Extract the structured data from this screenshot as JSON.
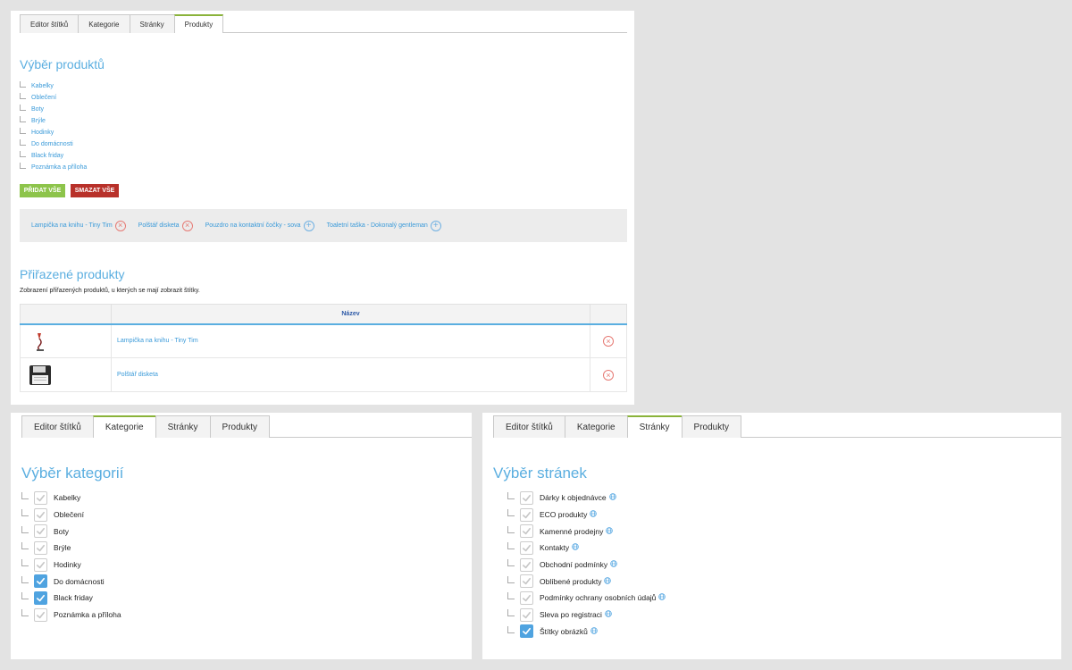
{
  "tabs": [
    "Editor štítků",
    "Kategorie",
    "Stránky",
    "Produkty"
  ],
  "products_panel": {
    "active_tab": "Produkty",
    "heading": "Výběr produktů",
    "tree": [
      "Kabelky",
      "Oblečení",
      "Boty",
      "Brýle",
      "Hodinky",
      "Do domácnosti",
      "Black friday",
      "Poznámka a příloha"
    ],
    "add_all_label": "PŘIDAT VŠE",
    "delete_all_label": "SMAZAT VŠE",
    "chips": [
      {
        "label": "Lampička na knihu - Tiny Tim",
        "action": "remove"
      },
      {
        "label": "Polštář disketa",
        "action": "remove"
      },
      {
        "label": "Pouzdro na kontaktní čočky - sova",
        "action": "add"
      },
      {
        "label": "Toaletní taška - Dokonalý gentleman",
        "action": "add"
      }
    ],
    "assigned_heading": "Přiřazené produkty",
    "assigned_description": "Zobrazení přiřazených produktů, u kterých se mají zobrazit štítky.",
    "table_header_name": "Název",
    "rows": [
      {
        "name": "Lampička na knihu - Tiny Tim",
        "image": "lamp-thumbnail"
      },
      {
        "name": "Polštář disketa",
        "image": "floppy-pillow-thumbnail"
      }
    ]
  },
  "categories_panel": {
    "active_tab": "Kategorie",
    "heading": "Výběr kategorií",
    "items": [
      {
        "label": "Kabelky",
        "checked": false
      },
      {
        "label": "Oblečení",
        "checked": false
      },
      {
        "label": "Boty",
        "checked": false
      },
      {
        "label": "Brýle",
        "checked": false
      },
      {
        "label": "Hodinky",
        "checked": false
      },
      {
        "label": "Do domácnosti",
        "checked": true
      },
      {
        "label": "Black friday",
        "checked": true
      },
      {
        "label": "Poznámka a příloha",
        "checked": false
      }
    ]
  },
  "pages_panel": {
    "active_tab": "Stránky",
    "heading": "Výběr stránek",
    "items": [
      {
        "label": "Dárky k objednávce",
        "checked": false
      },
      {
        "label": "ECO produkty",
        "checked": false
      },
      {
        "label": "Kamenné prodejny",
        "checked": false
      },
      {
        "label": "Kontakty",
        "checked": false
      },
      {
        "label": "Obchodní podmínky",
        "checked": false
      },
      {
        "label": "Oblíbené produkty",
        "checked": false
      },
      {
        "label": "Podmínky ochrany osobních údajů",
        "checked": false
      },
      {
        "label": "Sleva po registraci",
        "checked": false
      },
      {
        "label": "Štítky obrázků",
        "checked": true
      }
    ]
  },
  "colors": {
    "accent_blue": "#5aaee0",
    "link_blue": "#3a9ad9",
    "active_tab_green": "#8ab33a",
    "add_green": "#8dc44b",
    "delete_red": "#b8312a",
    "checkbox_on": "#4fa3e0"
  }
}
